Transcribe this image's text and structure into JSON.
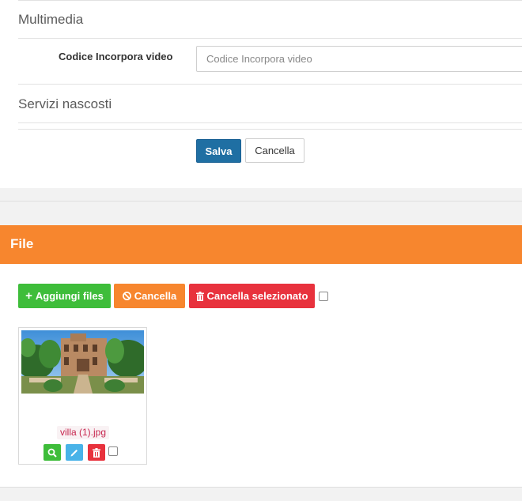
{
  "multimedia": {
    "heading": "Multimedia",
    "video_label": "Codice Incorpora video",
    "video_value": "",
    "video_placeholder": "Codice Incorpora video"
  },
  "hidden_services": {
    "heading": "Servizi nascosti"
  },
  "form_actions": {
    "save_label": "Salva",
    "cancel_label": "Cancella"
  },
  "files": {
    "title": "File",
    "add_label": "Aggiungi files",
    "cancel_label": "Cancella",
    "delete_selected_label": "Cancella selezionato",
    "select_all_checked": false,
    "items": [
      {
        "name": "villa (1).jpg",
        "checked": false
      }
    ]
  },
  "colors": {
    "primary": "#1f6fa3",
    "success": "#3ebd3a",
    "warning": "#f7862e",
    "danger": "#e8323d",
    "info": "#49b3e8"
  },
  "icons": {
    "add": "plus-icon",
    "cancel": "ban-icon",
    "delete": "trash-icon",
    "view": "search-icon",
    "edit": "pencil-icon"
  }
}
